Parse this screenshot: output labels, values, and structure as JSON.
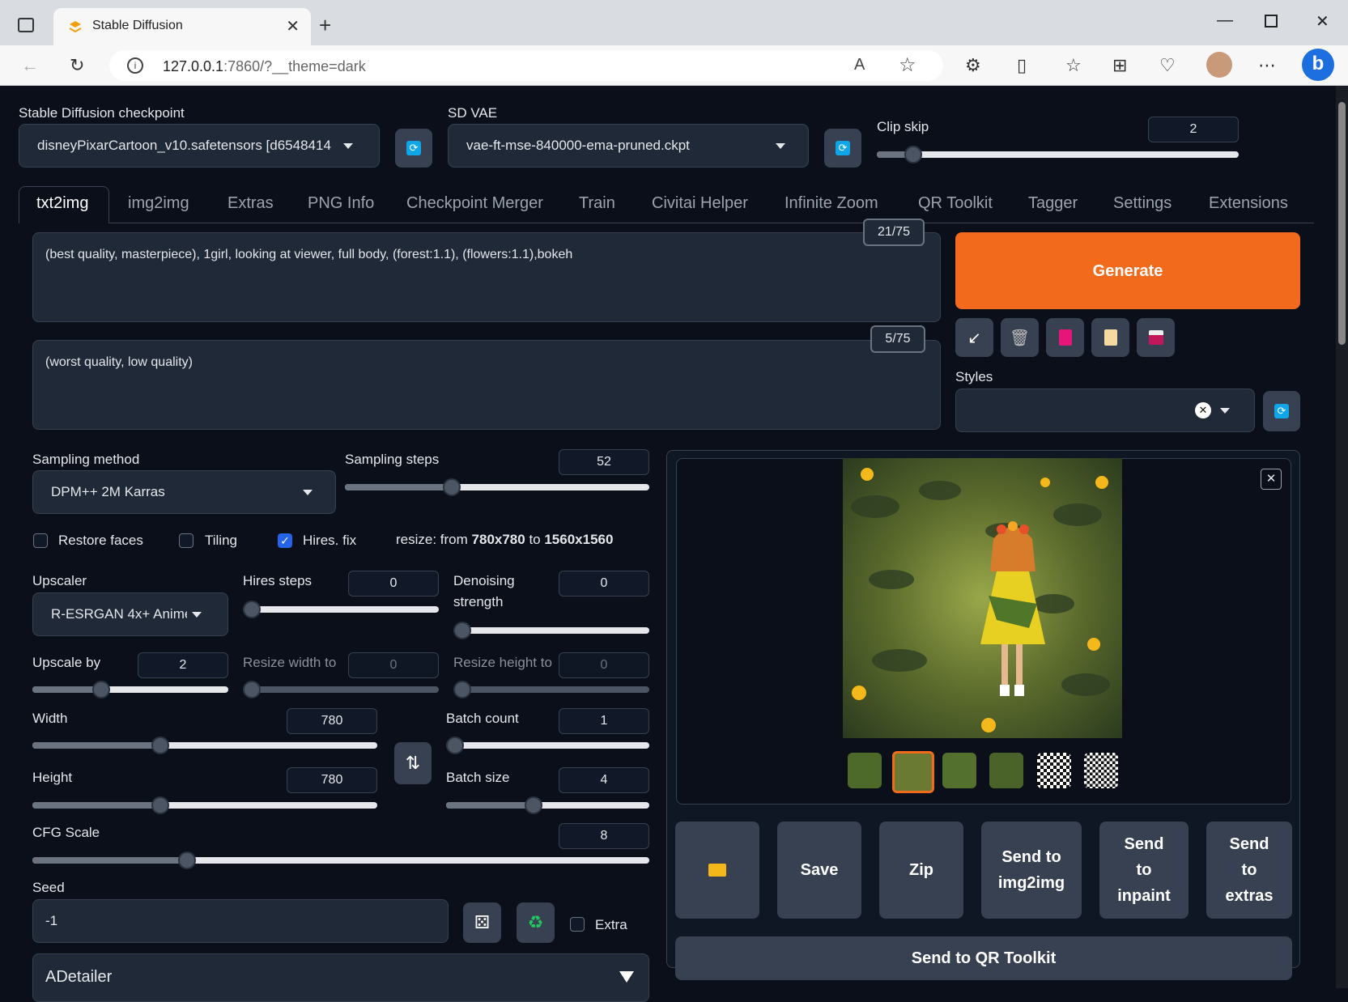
{
  "browser": {
    "tab_title": "Stable Diffusion",
    "url_host": "127.0.0.1",
    "url_rest": ":7860/?__theme=dark"
  },
  "top": {
    "checkpoint_label": "Stable Diffusion checkpoint",
    "checkpoint_value": "disneyPixarCartoon_v10.safetensors [d6548414",
    "vae_label": "SD VAE",
    "vae_value": "vae-ft-mse-840000-ema-pruned.ckpt",
    "clip_label": "Clip skip",
    "clip_value": "2"
  },
  "tabs": [
    "txt2img",
    "img2img",
    "Extras",
    "PNG Info",
    "Checkpoint Merger",
    "Train",
    "Civitai Helper",
    "Infinite Zoom",
    "QR Toolkit",
    "Tagger",
    "Settings",
    "Extensions"
  ],
  "prompt": {
    "positive": "(best quality, masterpiece), 1girl,  looking at viewer, full body, (forest:1.1), (flowers:1.1),bokeh",
    "positive_count": "21/75",
    "negative": "(worst quality, low quality)",
    "negative_count": "5/75"
  },
  "generate_label": "Generate",
  "styles_label": "Styles",
  "params": {
    "sampling_method_label": "Sampling method",
    "sampling_method_value": "DPM++ 2M Karras",
    "sampling_steps_label": "Sampling steps",
    "sampling_steps_value": "52",
    "restore_faces": "Restore faces",
    "tiling": "Tiling",
    "hires_fix": "Hires. fix",
    "resize_prefix": "resize: from ",
    "resize_from": "780x780",
    "resize_mid": " to ",
    "resize_to": "1560x1560",
    "upscaler_label": "Upscaler",
    "upscaler_value": "R-ESRGAN 4x+ Anime",
    "hires_steps_label": "Hires steps",
    "hires_steps_value": "0",
    "denoise_label_1": "Denoising",
    "denoise_label_2": "strength",
    "denoise_value": "0",
    "upscale_by_label": "Upscale by",
    "upscale_by_value": "2",
    "resize_width_label": "Resize width to",
    "resize_width_value": "0",
    "resize_height_label": "Resize height to",
    "resize_height_value": "0",
    "width_label": "Width",
    "width_value": "780",
    "height_label": "Height",
    "height_value": "780",
    "batch_count_label": "Batch count",
    "batch_count_value": "1",
    "batch_size_label": "Batch size",
    "batch_size_value": "4",
    "cfg_label": "CFG Scale",
    "cfg_value": "8",
    "seed_label": "Seed",
    "seed_value": "-1",
    "extra_label": "Extra",
    "adetailer_label": "ADetailer"
  },
  "output_buttons": {
    "save": "Save",
    "zip": "Zip",
    "send_img2img_1": "Send to",
    "send_img2img_2": "img2img",
    "send_inpaint_1": "Send",
    "send_inpaint_2": "to",
    "send_inpaint_3": "inpaint",
    "send_extras_1": "Send",
    "send_extras_2": "to",
    "send_extras_3": "extras",
    "send_qr": "Send to QR Toolkit"
  },
  "colors": {
    "accent": "#f26b1d",
    "background": "#0b0f19",
    "panel": "#1f2937"
  },
  "slider_levels": {
    "clip_skip": 0.1,
    "sampling_steps": 0.35,
    "hires_steps": 0.0,
    "denoise": 0.0,
    "upscale_by": 0.35,
    "resize_width": 0.0,
    "resize_height": 0.0,
    "width": 0.37,
    "height": 0.37,
    "batch_count": 0.0,
    "batch_size": 0.43,
    "cfg": 0.25
  }
}
